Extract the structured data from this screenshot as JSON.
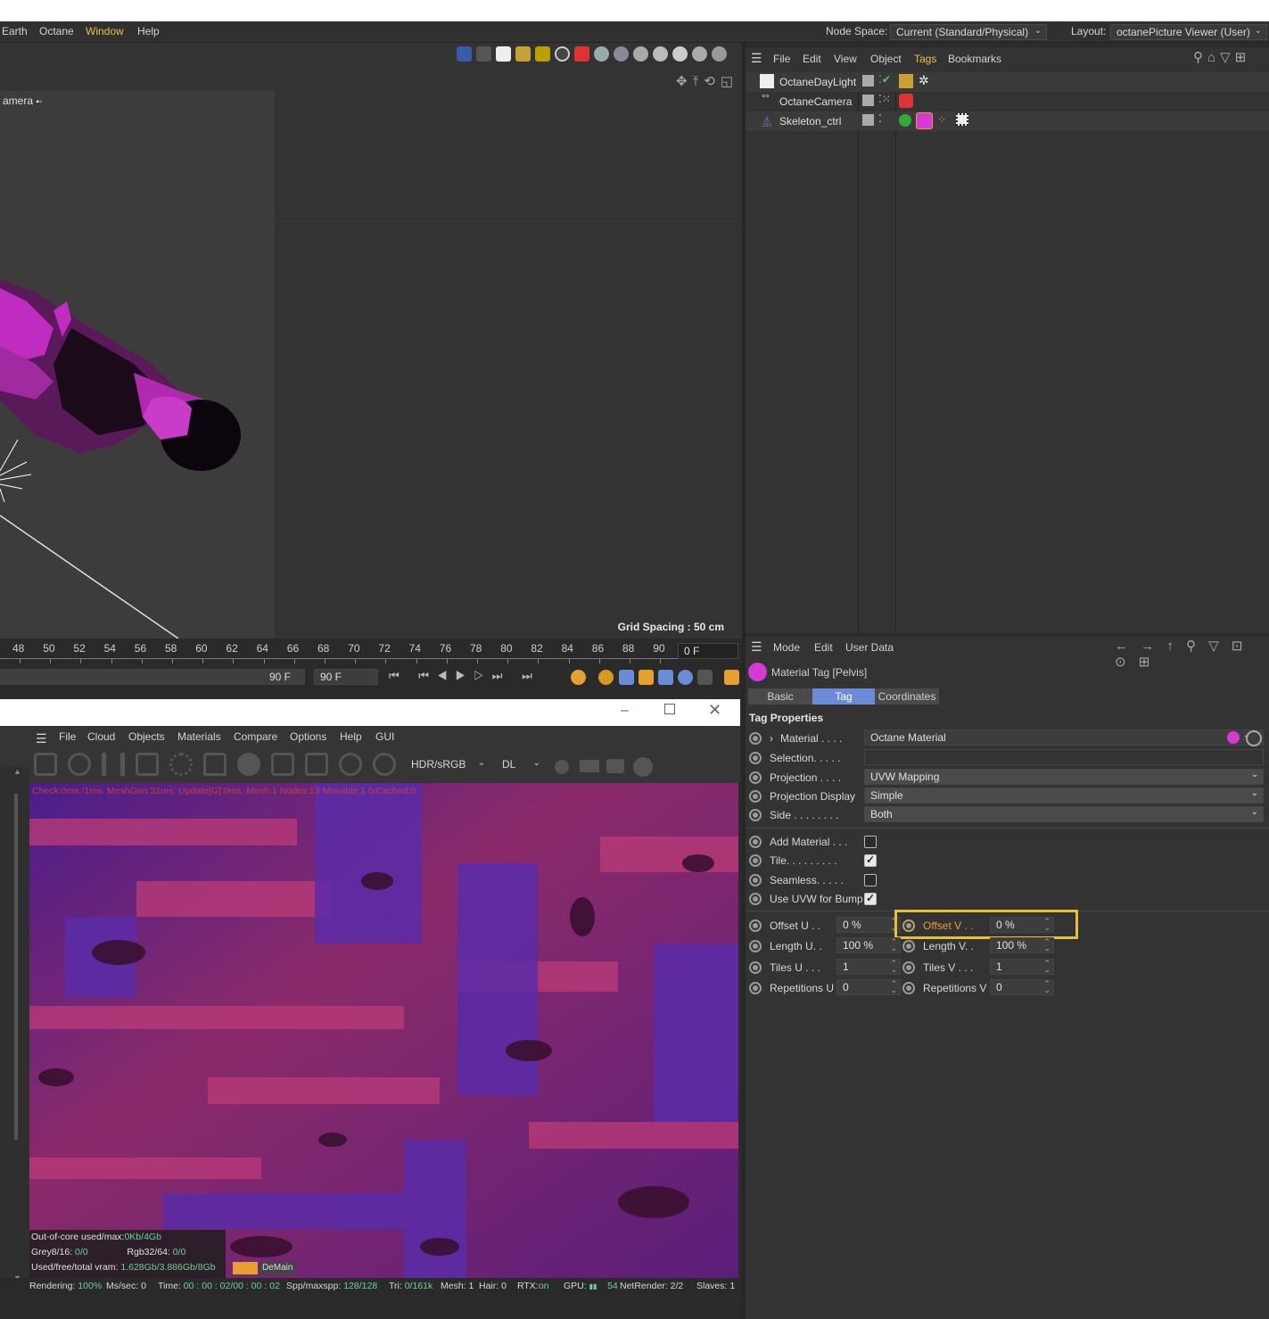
{
  "menubar": {
    "items": [
      "Earth",
      "Octane",
      "Window",
      "Help"
    ],
    "node_space_label": "Node Space:",
    "node_space_value": "Current (Standard/Physical)",
    "layout_label": "Layout:",
    "layout_value": "octanePicture Viewer (User)"
  },
  "viewport": {
    "camera_label": "amera",
    "grid_spacing": "Grid Spacing : 50 cm"
  },
  "timeline": {
    "ticks": [
      "48",
      "50",
      "52",
      "54",
      "56",
      "58",
      "60",
      "62",
      "64",
      "66",
      "68",
      "70",
      "72",
      "74",
      "76",
      "78",
      "80",
      "82",
      "84",
      "86",
      "88",
      "90"
    ],
    "current_frame": "0 F",
    "end_frame_a": "90 F",
    "end_frame_b": "90 F"
  },
  "object_manager": {
    "menu": [
      "File",
      "Edit",
      "View",
      "Object",
      "Tags",
      "Bookmarks"
    ],
    "objects": [
      "OctaneDayLight",
      "OctaneCamera",
      "Skeleton_ctrl"
    ]
  },
  "attribute_manager": {
    "menu": [
      "Mode",
      "Edit",
      "User Data"
    ],
    "header": "Material Tag [Pelvis]",
    "tabs": [
      "Basic",
      "Tag",
      "Coordinates"
    ],
    "section_title": "Tag Properties",
    "material_label": "Material . . . .",
    "material_value": "Octane Material",
    "selection_label": "Selection. . . . .",
    "projection_label": "Projection . . . .",
    "projection_value": "UVW Mapping",
    "projection_display_label": "Projection Display",
    "projection_display_value": "Simple",
    "side_label": "Side . . . . . . . .",
    "side_value": "Both",
    "add_material_label": "Add Material . . .",
    "tile_label": "Tile. . . . . . . . .",
    "seamless_label": "Seamless. . . . .",
    "uvw_bump_label": "Use UVW for Bump",
    "add_material_checked": false,
    "tile_checked": true,
    "seamless_checked": false,
    "uvw_bump_checked": true,
    "offset_u_label": "Offset U . .",
    "offset_u_value": "0 %",
    "offset_v_label": "Offset V . .",
    "offset_v_value": "0 %",
    "length_u_label": "Length U. .",
    "length_u_value": "100 %",
    "length_v_label": "Length V. .",
    "length_v_value": "100 %",
    "tiles_u_label": "Tiles U . . .",
    "tiles_u_value": "1",
    "tiles_v_label": "Tiles V . . .",
    "tiles_v_value": "1",
    "repetitions_u_label": "Repetitions U",
    "repetitions_u_value": "0",
    "repetitions_v_label": "Repetitions V",
    "repetitions_v_value": "0"
  },
  "octane": {
    "menu": [
      "File",
      "Cloud",
      "Objects",
      "Materials",
      "Compare",
      "Options",
      "Help",
      "GUI"
    ],
    "color_space": "HDR/sRGB",
    "kernel": "DL",
    "overlay_text": "Check:0ms./1ms. MeshGen:31ms. Update[G]:0ms. Mesh:1 Nodes:13 Movable:1 txCached:0",
    "ooc_label": "Out-of-core used/max:",
    "ooc_value": "0Kb/4Gb",
    "grey_label": "Grey8/16:",
    "grey_value": "0/0",
    "rgb_label": "Rgb32/64:",
    "rgb_value": "0/0",
    "vram_label": "Used/free/total vram:",
    "vram_value": "1.628Gb/3.886Gb/8Gb",
    "main_label": "Main",
    "demain_label": "DeMain",
    "status": {
      "rendering_label": "Rendering:",
      "rendering_value": "100%",
      "ms_label": "Ms/sec:",
      "ms_value": "0",
      "time_label": "Time:",
      "time_value": "00 : 00 : 02/00 : 00 : 02",
      "spp_label": "Spp/maxspp:",
      "spp_value": "128/128",
      "tri_label": "Tri:",
      "tri_value": "0/161k",
      "mesh_label": "Mesh:",
      "mesh_value": "1",
      "hair_label": "Hair:",
      "hair_value": "0",
      "rtx_label": "RTX:",
      "rtx_value": "on",
      "gpu_label": "GPU:",
      "gpu_value": "54",
      "netrender_label": "NetRender:",
      "netrender_value": "2/2",
      "slaves_label": "Slaves:",
      "slaves_value": "1"
    }
  },
  "colors": {
    "accent": "#e6b43c",
    "tab_active": "#6b8bd6",
    "highlight_box": "#e8c036"
  }
}
